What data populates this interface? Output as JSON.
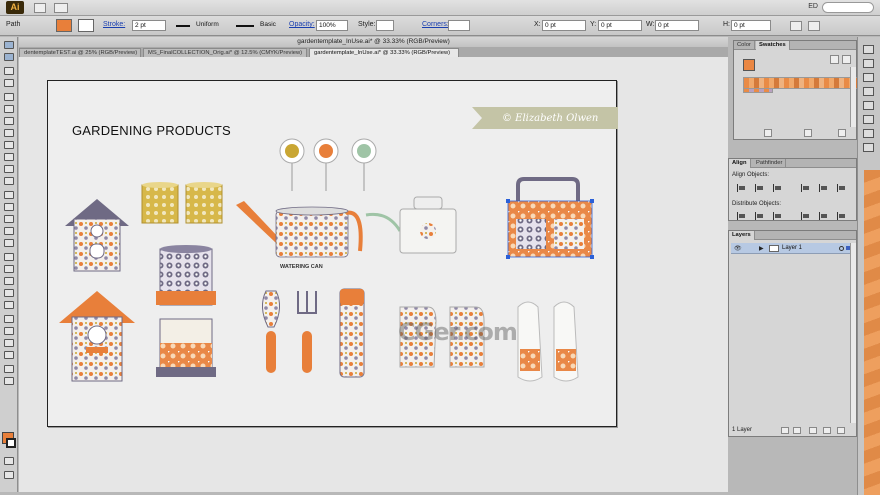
{
  "menubar": {
    "app_icon": "Ai",
    "right_text": "ED"
  },
  "controlbar": {
    "selection_label": "Path",
    "stroke_label": "Stroke:",
    "stroke_value": "2 pt",
    "profile_value": "Uniform",
    "brush_value": "Basic",
    "opacity_label": "Opacity:",
    "opacity_value": "100%",
    "style_label": "Style:",
    "corners_label": "Corners:",
    "x_label": "X:",
    "x_value": "0 pt",
    "y_label": "Y:",
    "y_value": "0 pt",
    "w_label": "W:",
    "w_value": "0 pt",
    "h_label": "H:",
    "h_value": "0 pt",
    "fill_color": "#e87f3a"
  },
  "document": {
    "window_title": "gardentemplate_InUse.ai* @ 33.33% (RGB/Preview)",
    "tabs": [
      {
        "label": "dentemplateTEST.ai @ 25% (RGB/Preview)"
      },
      {
        "label": "MS_FinalCOLLECTION_Orig.ai* @ 12.5% (CMYK/Preview)"
      },
      {
        "label": "gardentemplate_InUse.ai* @ 33.33% (RGB/Preview)"
      }
    ],
    "artboard": {
      "title": "GARDENING PRODUCTS",
      "signature": "© Elizabeth Olwen",
      "watering_can_label": "WATERING CAN",
      "watermark": "CGer.com"
    }
  },
  "swatches_panel": {
    "tabs": [
      {
        "label": "Color"
      },
      {
        "label": "Swatches"
      }
    ]
  },
  "align_panel": {
    "tabs": [
      {
        "label": "Align"
      },
      {
        "label": "Pathfinder"
      }
    ],
    "align_objects_label": "Align Objects:",
    "distribute_objects_label": "Distribute Objects:"
  },
  "layers_panel": {
    "tab_label": "Layers",
    "layer_name": "Layer 1",
    "footer": "1 Layer"
  },
  "colors": {
    "orange": "#e87f3a",
    "purple": "#6f6a84",
    "mustard": "#c9a633",
    "mint": "#9fc4a6",
    "selection_blue": "#b7c9e3"
  }
}
